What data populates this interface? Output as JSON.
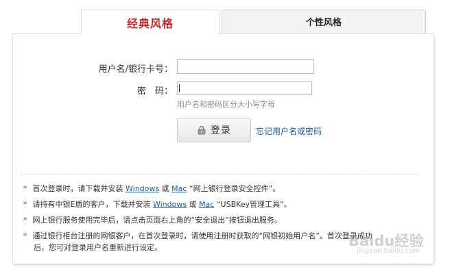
{
  "tabs": [
    {
      "label": "经典风格"
    },
    {
      "label": "个性风格"
    }
  ],
  "form": {
    "username_label": "用户名/银行卡号：",
    "password_label": "密　码：",
    "hint": "用户名和密码区分大小写字母",
    "login_label": "登录",
    "forgot_label": "忘记用户名或密码"
  },
  "notes": [
    {
      "before": "首次登录时，请下载并安装 ",
      "link1": "Windows",
      "mid": " 或 ",
      "link2": "Mac",
      "after": " “网上银行登录安全控件”。"
    },
    {
      "before": "请持有中银E盾的客户，下载并安装 ",
      "link1": "Windows",
      "mid": " 或 ",
      "link2": "Mac",
      "after": " “USBKey管理工具”。"
    },
    {
      "text": "网上银行服务使用完毕后，请点击页面右上角的“安全退出”按钮退出服务。"
    },
    {
      "line1": "通过银行柜台注册的网银客户，在首次登录时，请使用注册时获取的“网银初始用户名”。首次登录成功",
      "line2": "后，您可对登录用户名重新进行设定。"
    }
  ],
  "star": "*",
  "watermark": {
    "text": "Baidu经验",
    "sub": "jingyan.baidu.com"
  },
  "colors": {
    "accent": "#c0282d",
    "link": "#1a5a9a"
  }
}
